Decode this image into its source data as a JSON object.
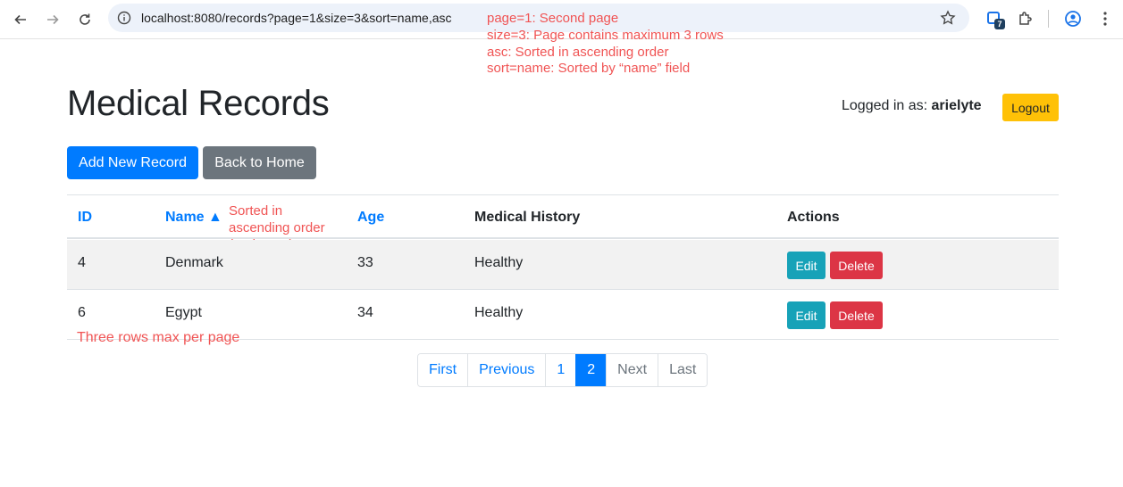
{
  "browser": {
    "url": "localhost:8080/records?page=1&size=3&sort=name,asc",
    "extension_badge": "7"
  },
  "annotations": {
    "url_notes": [
      "page=1: Second page",
      "size=3: Page contains maximum 3 rows",
      "asc: Sorted in ascending order",
      "sort=name: Sorted by “name” field"
    ],
    "sort_note": [
      "Sorted in",
      "ascending order",
      "(2nd page)"
    ],
    "rows_note": "Three rows max per page",
    "color": "#f05454"
  },
  "page": {
    "title": "Medical Records",
    "logged_in_label": "Logged in as:",
    "username": "arielyte",
    "logout_label": "Logout",
    "add_label": "Add New Record",
    "home_label": "Back to Home"
  },
  "table": {
    "headers": {
      "id": "ID",
      "name": "Name ▲",
      "age": "Age",
      "history": "Medical History",
      "actions": "Actions"
    },
    "rows": [
      {
        "id": "4",
        "name": "Denmark",
        "age": "33",
        "history": "Healthy",
        "edit": "Edit",
        "delete": "Delete"
      },
      {
        "id": "6",
        "name": "Egypt",
        "age": "34",
        "history": "Healthy",
        "edit": "Edit",
        "delete": "Delete"
      }
    ]
  },
  "pagination": {
    "first": "First",
    "previous": "Previous",
    "page1": "1",
    "page2": "2",
    "next": "Next",
    "last": "Last"
  },
  "colors": {
    "primary": "#007bff",
    "secondary": "#6c757d",
    "warning": "#ffc107",
    "info": "#17a2b8",
    "danger": "#dc3545"
  }
}
